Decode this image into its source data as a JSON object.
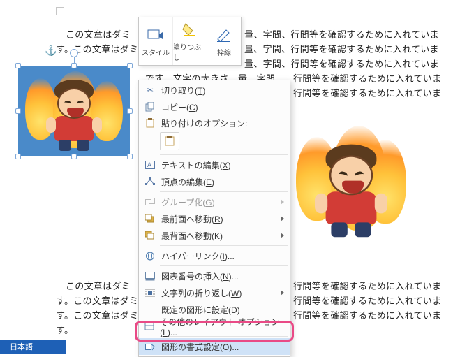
{
  "doc_lines": {
    "l1_left": "この文章はダミ",
    "l1_right": "量、字間、行間等を確認するために入れていま",
    "l2_left": "す。この文章はダミ",
    "l2_right": "量、字間、行間等を確認するために入れていま",
    "l3_right": "量、字間、行間等を確認するために入れていま",
    "l4_mid": "です　文字の大きさ　量　字間",
    "l4_right": "行間等を確認するために入れていま",
    "l5_right": "行間等を確認するために入れていま",
    "l6_left": "この文章はダミ",
    "l6_right": "行間等を確認するために入れていま",
    "l7_left": "す。この文章はダミ",
    "l7_right": "行間等を確認するために入れていま",
    "l8_left": "す。この文章はダミ",
    "l8_right": "行間等を確認するために入れていま",
    "l9_left": "す。"
  },
  "mini_toolbar": {
    "style": "スタイル",
    "fill": "塗りつぶし",
    "outline": "枠線"
  },
  "context_menu": {
    "cut": "切り取り(",
    "cut_key": "T",
    "cut_suffix": ")",
    "copy": "コピー(",
    "copy_key": "C",
    "copy_suffix": ")",
    "paste_header": "貼り付けのオプション:",
    "edit_text": "テキストの編集(",
    "edit_text_key": "X",
    "edit_text_suffix": ")",
    "edit_points": "頂点の編集(",
    "edit_points_key": "E",
    "edit_points_suffix": ")",
    "group": "グループ化(",
    "group_key": "G",
    "group_suffix": ")",
    "bring_front": "最前面へ移動(",
    "bring_front_key": "R",
    "bring_front_suffix": ")",
    "send_back": "最背面へ移動(",
    "send_back_key": "K",
    "send_back_suffix": ")",
    "hyperlink": "ハイパーリンク(",
    "hyperlink_key": "I",
    "hyperlink_suffix": ")...",
    "caption": "図表番号の挿入(",
    "caption_key": "N",
    "caption_suffix": ")...",
    "wrap": "文字列の折り返し(",
    "wrap_key": "W",
    "wrap_suffix": ")",
    "default_shape": "既定の図形に設定(",
    "default_shape_key": "D",
    "default_shape_suffix": ")",
    "more_layout": "その他のレイアウト オプション(",
    "more_layout_key": "L",
    "more_layout_suffix": ")...",
    "format_shape": "図形の書式設定(",
    "format_shape_key": "O",
    "format_shape_suffix": ")..."
  },
  "status": {
    "language": "日本語"
  }
}
